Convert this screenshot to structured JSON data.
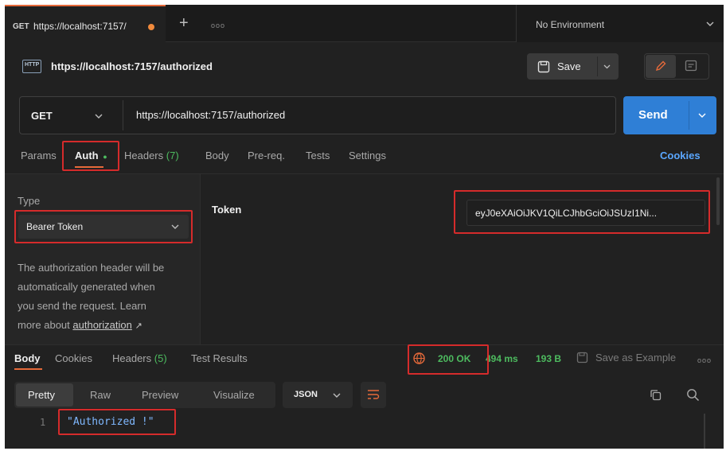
{
  "tab": {
    "method": "GET",
    "title": "https://localhost:7157/",
    "more": "ooo"
  },
  "environment": {
    "label": "No Environment"
  },
  "request": {
    "icon_label": "HTTP",
    "name": "https://localhost:7157/authorized",
    "save_label": "Save",
    "method": "GET",
    "url": "https://localhost:7157/authorized",
    "send_label": "Send"
  },
  "request_tabs": [
    {
      "label": "Params"
    },
    {
      "label": "Auth"
    },
    {
      "label": "Headers",
      "count": "(7)"
    },
    {
      "label": "Body"
    },
    {
      "label": "Pre-req."
    },
    {
      "label": "Tests"
    },
    {
      "label": "Settings"
    }
  ],
  "cookies_link": "Cookies",
  "auth": {
    "type_label": "Type",
    "type_value": "Bearer Token",
    "description": "The authorization header will be automatically generated when you send the request. Learn more about",
    "description_lines": [
      "The authorization header will be",
      "automatically generated when",
      "you send the request. Learn",
      "more about"
    ],
    "link_text": "authorization",
    "link_arrow": "↗",
    "token_label": "Token",
    "token_value": "eyJ0eXAiOiJKV1QiLCJhbGciOiJSUzI1Ni..."
  },
  "response": {
    "tabs": [
      {
        "label": "Body"
      },
      {
        "label": "Cookies"
      },
      {
        "label": "Headers",
        "count": "(5)"
      },
      {
        "label": "Test Results"
      }
    ],
    "status": "200 OK",
    "time": "494 ms",
    "size": "193 B",
    "save_example": "Save as Example",
    "more": "ooo",
    "view_tabs": [
      {
        "label": "Pretty"
      },
      {
        "label": "Raw"
      },
      {
        "label": "Preview"
      },
      {
        "label": "Visualize"
      }
    ],
    "format": "JSON",
    "line_number": "1",
    "body_line": "\"Authorized !\""
  },
  "colors": {
    "accent_blue": "#2f7fd6",
    "status_green": "#4dbb5f",
    "highlight_red": "#d52b2b",
    "tab_orange": "#f08a3c"
  }
}
